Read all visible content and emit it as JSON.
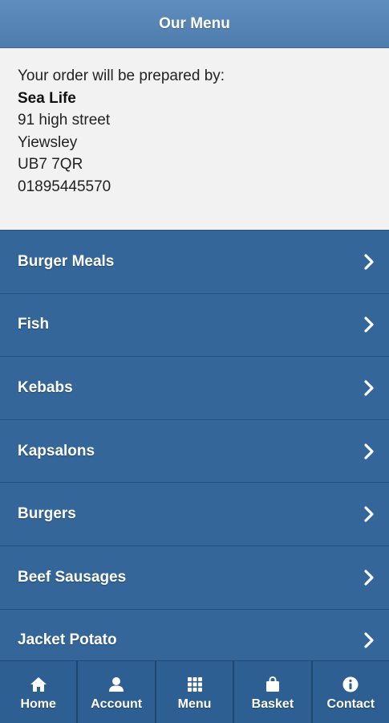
{
  "header": {
    "title": "Our Menu"
  },
  "store": {
    "intro": "Your order will be prepared by:",
    "name": "Sea Life",
    "address_line1": "91 high street",
    "town": "Yiewsley",
    "postcode": "UB7 7QR",
    "phone": "01895445570"
  },
  "menu": {
    "items": [
      {
        "label": "Burger Meals"
      },
      {
        "label": "Fish"
      },
      {
        "label": "Kebabs"
      },
      {
        "label": "Kapsalons"
      },
      {
        "label": "Burgers"
      },
      {
        "label": "Beef Sausages"
      },
      {
        "label": "Jacket Potato"
      }
    ]
  },
  "tabs": [
    {
      "label": "Home",
      "icon": "home-icon"
    },
    {
      "label": "Account",
      "icon": "user-icon"
    },
    {
      "label": "Menu",
      "icon": "grid-icon"
    },
    {
      "label": "Basket",
      "icon": "bag-icon"
    },
    {
      "label": "Contact",
      "icon": "info-icon"
    }
  ],
  "colors": {
    "header": "#5a89b9",
    "menu_item_bg": "#34669a",
    "info_bg": "#f2f2f2",
    "tabbar_bg": "#2e5f92",
    "text_light": "#ffffff"
  }
}
